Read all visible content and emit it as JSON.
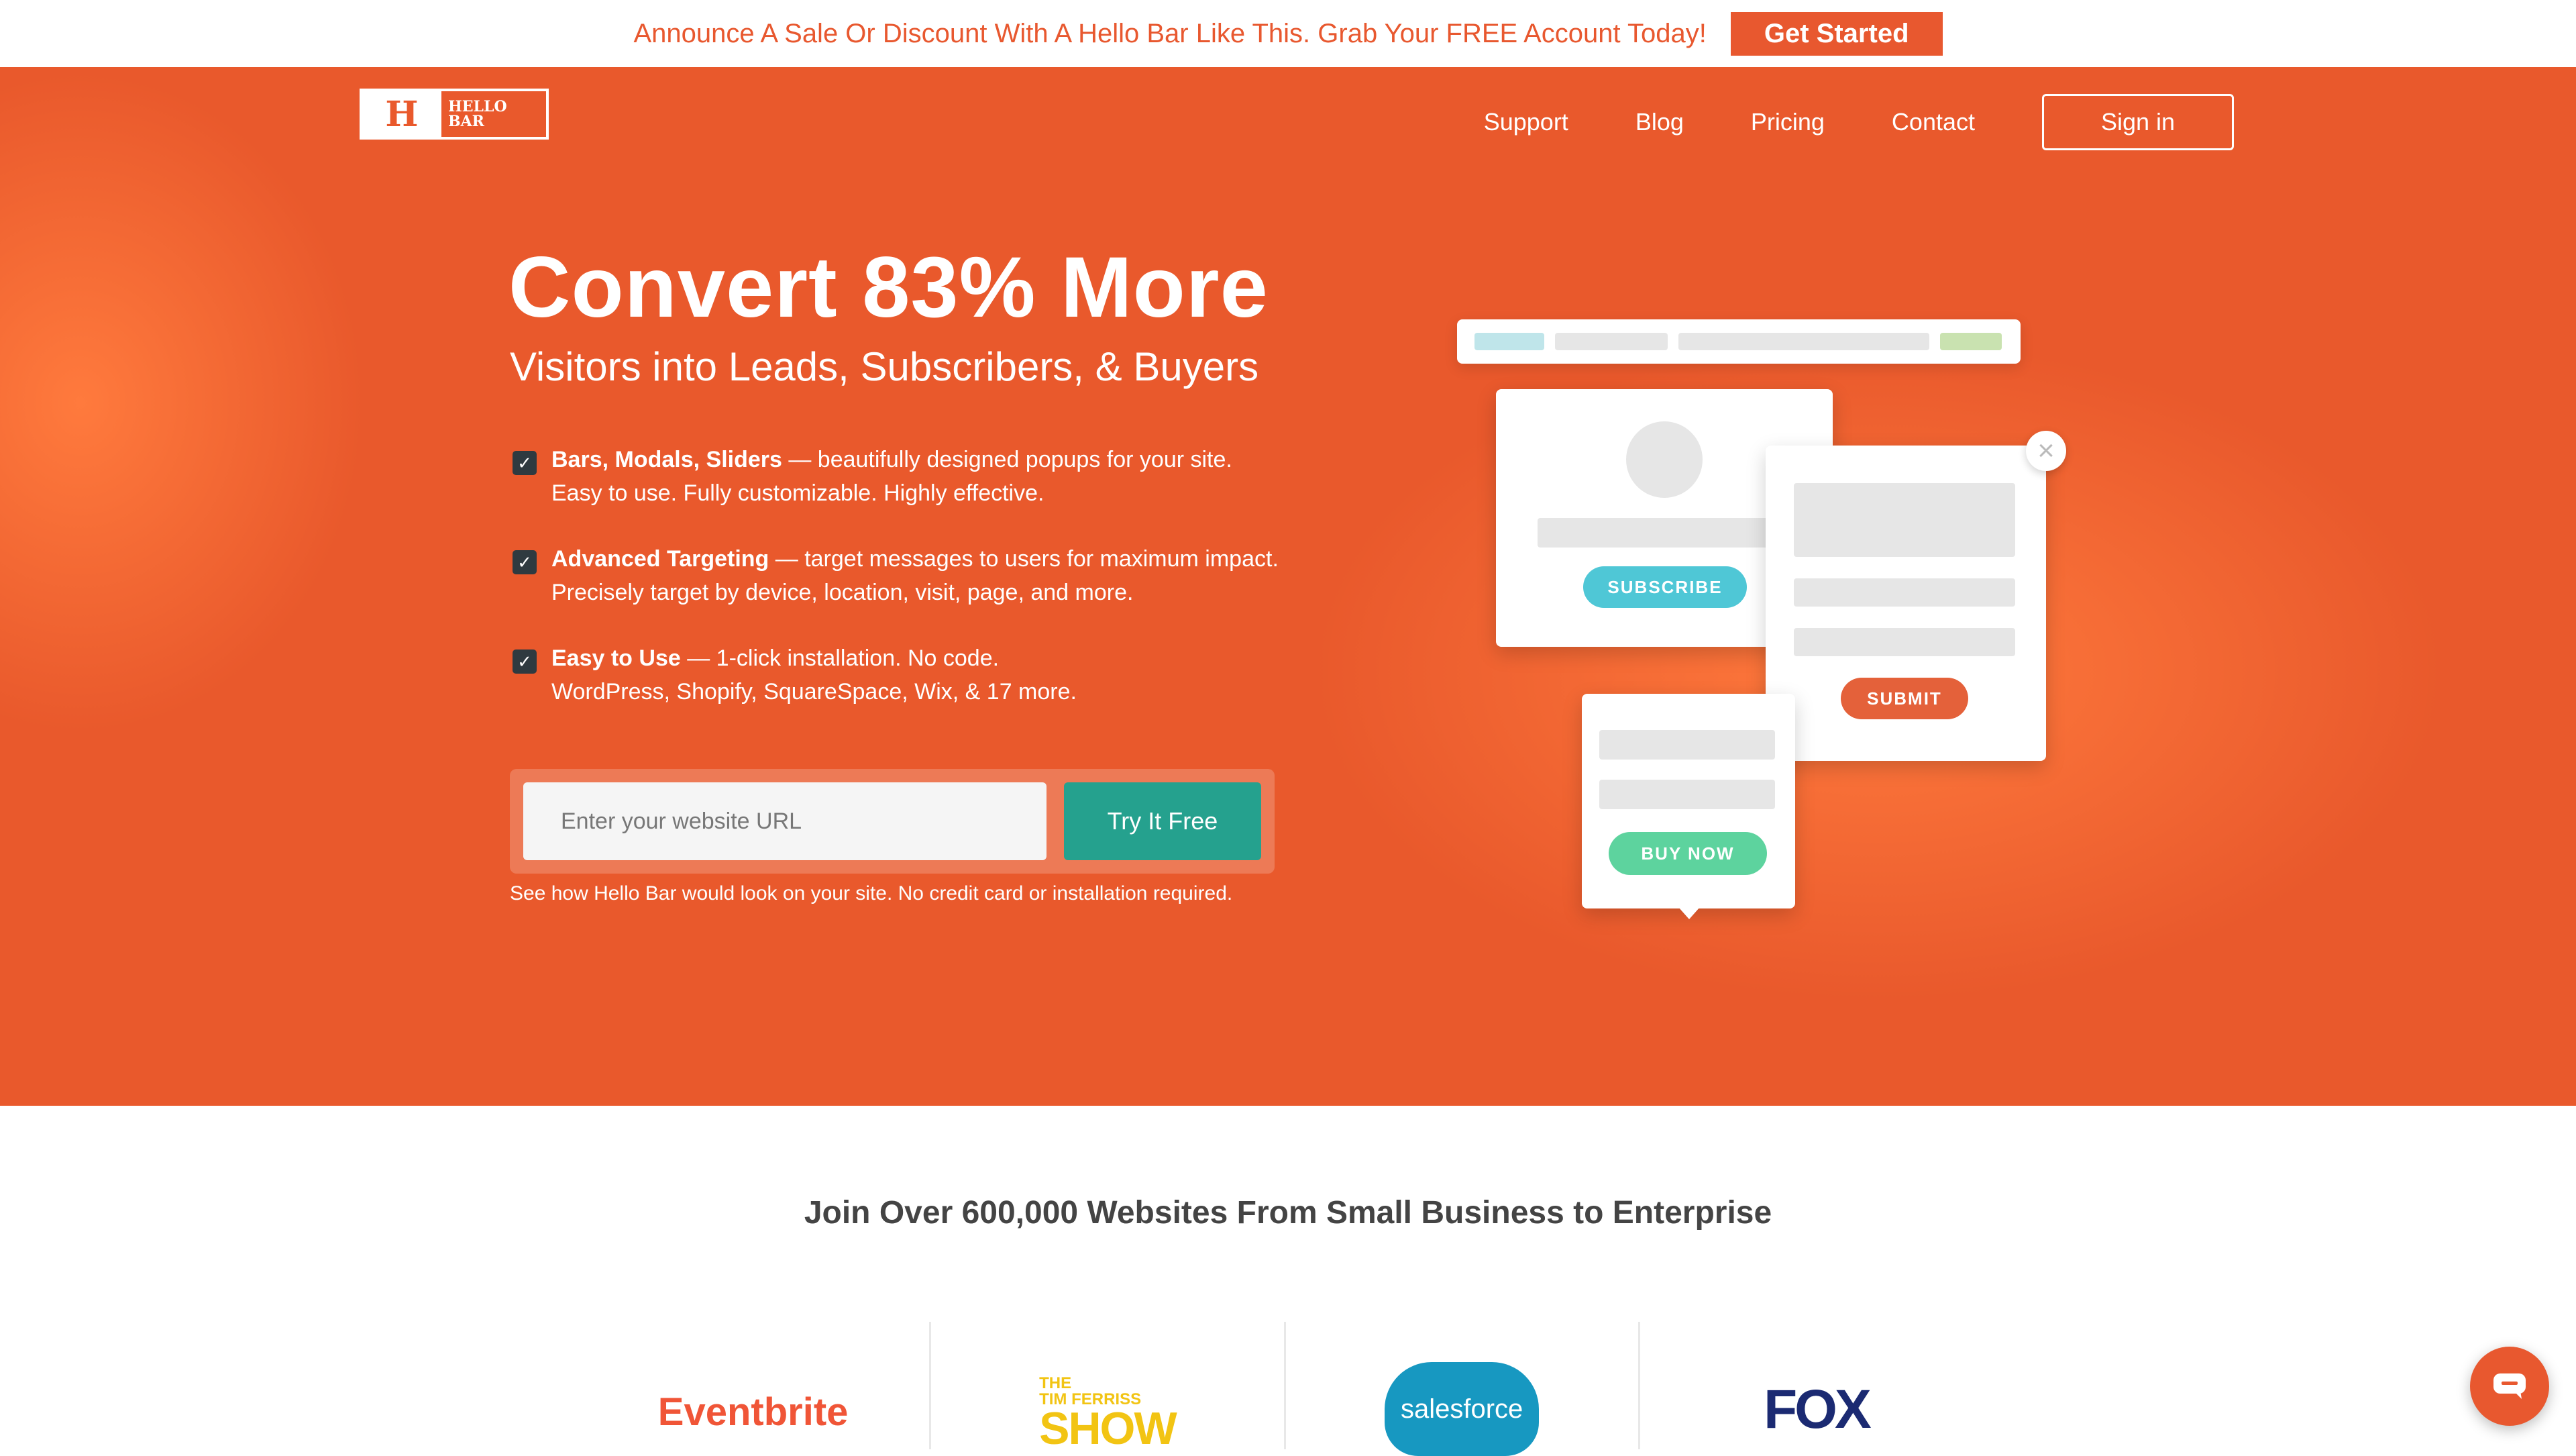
{
  "topbar": {
    "message": "Announce A Sale Or Discount With A Hello Bar Like This. Grab Your FREE Account Today!",
    "cta_label": "Get Started"
  },
  "header": {
    "logo_mark": "H",
    "logo_line1": "HELLO",
    "logo_line2": "BAR",
    "nav": [
      "Support",
      "Blog",
      "Pricing",
      "Contact"
    ],
    "signin_label": "Sign in"
  },
  "hero": {
    "headline": "Convert 83% More",
    "subheadline": "Visitors into Leads, Subscribers, & Buyers",
    "features": [
      {
        "bold": "Bars, Modals, Sliders",
        "rest": " — beautifully designed popups for your site.",
        "line2": "Easy to use. Fully customizable. Highly effective."
      },
      {
        "bold": "Advanced Targeting",
        "rest": " — target messages to users for maximum impact.",
        "line2": "Precisely target by device, location, visit, page, and more."
      },
      {
        "bold": "Easy to Use",
        "rest": " — 1-click installation. No code.",
        "line2": "WordPress, Shopify, SquareSpace, Wix, & 17 more."
      }
    ],
    "url_placeholder": "Enter your website URL",
    "try_label": "Try It Free",
    "disclaimer": "See how Hello Bar would look on your site. No credit card or installation required."
  },
  "illustration": {
    "subscribe_label": "SUBSCRIBE",
    "submit_label": "SUBMIT",
    "buy_now_label": "BUY NOW",
    "close_glyph": "×"
  },
  "customers": {
    "title": "Join Over 600,000 Websites From Small Business to Enterprise",
    "eventbrite": "Eventbrite",
    "tf_line1": "THE",
    "tf_line2": "TIM FERRISS",
    "tf_line3": "SHOW",
    "salesforce": "salesforce",
    "fox": "FOX"
  },
  "colors": {
    "brand_orange": "#e9592c",
    "teal": "#25a18e",
    "subscribe": "#4fc7d6",
    "submit": "#e4613a",
    "buy_now": "#5dd39e"
  }
}
